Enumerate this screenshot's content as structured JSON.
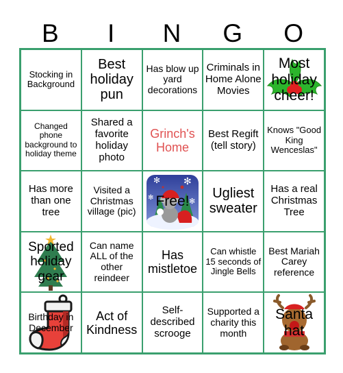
{
  "header": {
    "letters": [
      "B",
      "I",
      "N",
      "G",
      "O"
    ]
  },
  "colors": {
    "grid_border": "#3a9f6e",
    "highlight_text": "#e05252"
  },
  "cells": [
    [
      "Stocking in Background",
      "Best holiday pun",
      "Has blow up yard decorations",
      "Criminals in Home Alone Movies",
      "Most holiday cheer!"
    ],
    [
      "Changed phone background to holiday theme",
      "Shared a favorite holiday photo",
      "Grinch's Home",
      "Best Regift (tell story)",
      "Knows \"Good King Wenceslas\""
    ],
    [
      "Has more than one tree",
      "Visited a Christmas village (pic)",
      "Free!",
      "Ugliest sweater",
      "Has a real Christmas Tree"
    ],
    [
      "Sported holiday gear",
      "Can name ALL of the other reindeer",
      "Has mistletoe",
      "Can whistle 15 seconds of Jingle Bells",
      "Best Mariah Carey reference"
    ],
    [
      "Birthday in December",
      "Act of Kindness",
      "Self-described scrooge",
      "Supported a charity this month",
      "Santa hat"
    ]
  ],
  "cell_images": {
    "0_4": "holly-icon",
    "2_2": "snow-globe-koala-icon",
    "3_0": "christmas-tree-icon",
    "4_0": "stocking-icon",
    "4_4": "reindeer-icon"
  }
}
